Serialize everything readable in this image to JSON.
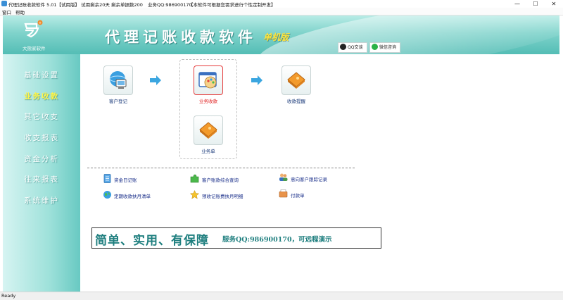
{
  "window": {
    "title": "代理记账收款软件 5.01【试用版】 试用剩余20天  剩余单据数200",
    "service_qq": "业务QQ:986900170",
    "notice": "【本软件可根据您需求进行个性定制开发】",
    "controls": {
      "minimize": "—",
      "maximize": "☐",
      "close": "✕"
    }
  },
  "menu": {
    "items": [
      "窗口",
      "帮助"
    ]
  },
  "banner": {
    "logo_text": "大熊家软件",
    "title": "代理记账收款软件",
    "edition": "单机版",
    "qq_chip": "QQ交谈",
    "wechat_chip": "微信咨询"
  },
  "sidebar": {
    "items": [
      "基础设置",
      "业务收款",
      "其它收支",
      "收支报表",
      "资金分析",
      "往来报表",
      "系统维护"
    ],
    "active_index": 1
  },
  "workflow": {
    "tiles": [
      {
        "label": "客户登记",
        "icon": "computer-globe-icon"
      },
      {
        "label": "业务收款",
        "icon": "palette-window-icon",
        "selected": true
      },
      {
        "label": "收款提醒",
        "icon": "orange-book-icon"
      },
      {
        "label": "业务单",
        "icon": "orange-book-icon"
      }
    ]
  },
  "links": [
    {
      "label": "资金日记账",
      "icon": "ledger-icon"
    },
    {
      "label": "客户账款综合查询",
      "icon": "puzzle-icon"
    },
    {
      "label": "意向客户跟踪记录",
      "icon": "users-icon"
    },
    {
      "label": "定期收款扶月清单",
      "icon": "globe-icon"
    },
    {
      "label": "预收记账费扶月明细",
      "icon": "star-icon"
    },
    {
      "label": "付款单",
      "icon": "inbox-icon"
    }
  ],
  "slogan": {
    "main": "简单、实用、有保障",
    "sub": "服务QQ:986900170，可远程演示"
  },
  "status": {
    "text": "Ready"
  },
  "colors": {
    "banner": "#7fd3cb",
    "sidebar": "#9ee1da",
    "active_nav": "#fff54a",
    "slogan": "#1f7f7f",
    "selected_border": "#e53b3b"
  }
}
